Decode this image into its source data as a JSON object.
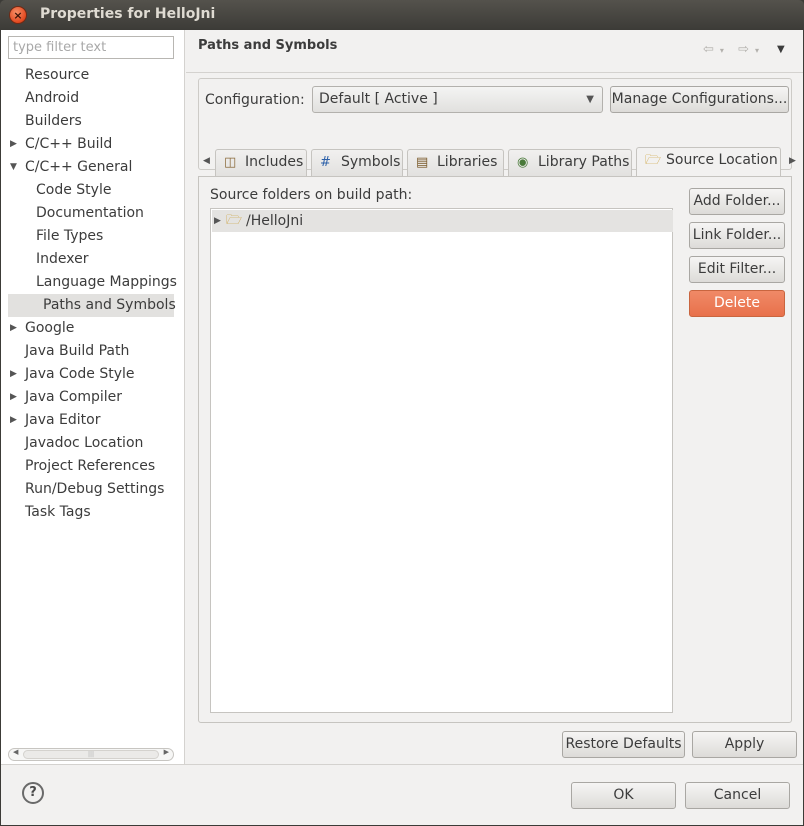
{
  "window": {
    "title": "Properties for HelloJni",
    "close_glyph": "×"
  },
  "sidebar": {
    "filter_placeholder": "type filter text",
    "items": [
      {
        "label": "Resource",
        "expandable": false
      },
      {
        "label": "Android",
        "expandable": false
      },
      {
        "label": "Builders",
        "expandable": false
      },
      {
        "label": "C/C++ Build",
        "expandable": true,
        "expanded": false
      },
      {
        "label": "C/C++ General",
        "expandable": true,
        "expanded": true
      },
      {
        "label": "Code Style",
        "child": true
      },
      {
        "label": "Documentation",
        "child": true
      },
      {
        "label": "File Types",
        "child": true
      },
      {
        "label": "Indexer",
        "child": true
      },
      {
        "label": "Language Mappings",
        "child": true
      },
      {
        "label": "Paths and Symbols",
        "child": true,
        "selected": true
      },
      {
        "label": "Google",
        "expandable": true,
        "expanded": false
      },
      {
        "label": "Java Build Path",
        "expandable": false
      },
      {
        "label": "Java Code Style",
        "expandable": true,
        "expanded": false
      },
      {
        "label": "Java Compiler",
        "expandable": true,
        "expanded": false
      },
      {
        "label": "Java Editor",
        "expandable": true,
        "expanded": false
      },
      {
        "label": "Javadoc Location",
        "expandable": false
      },
      {
        "label": "Project References",
        "expandable": false
      },
      {
        "label": "Run/Debug Settings",
        "expandable": false
      },
      {
        "label": "Task Tags",
        "expandable": false
      }
    ],
    "scrollbar_grip": "|||"
  },
  "page": {
    "title": "Paths and Symbols",
    "back_icon": "⇦",
    "forward_icon": "⇨",
    "menu_glyph": "▼"
  },
  "configuration": {
    "label": "Configuration:",
    "selected": "Default  [ Active ]",
    "manage_button": "Manage Configurations..."
  },
  "tabs": [
    {
      "label": "Includes",
      "icon": "includes-icon",
      "glyph": "◫"
    },
    {
      "label": "Symbols",
      "icon": "hash-icon",
      "glyph": "#"
    },
    {
      "label": "Libraries",
      "icon": "books-icon",
      "glyph": "▤"
    },
    {
      "label": "Library Paths",
      "icon": "library-path-icon",
      "glyph": "◉"
    },
    {
      "label": "Source Location",
      "icon": "folder-icon",
      "glyph": "🗁",
      "active": true
    }
  ],
  "source_location": {
    "heading": "Source folders on build path:",
    "folders": [
      {
        "name": "/HelloJni"
      }
    ],
    "buttons": {
      "add_folder": "Add Folder...",
      "link_folder": "Link Folder...",
      "edit_filter": "Edit Filter...",
      "delete": "Delete"
    }
  },
  "footer": {
    "restore_defaults": "Restore Defaults",
    "apply": "Apply",
    "ok": "OK",
    "cancel": "Cancel",
    "help_glyph": "?"
  },
  "colors": {
    "delete_button": "#e8714b",
    "selection": "#e2e1df",
    "titlebar": "#3c3b37"
  }
}
